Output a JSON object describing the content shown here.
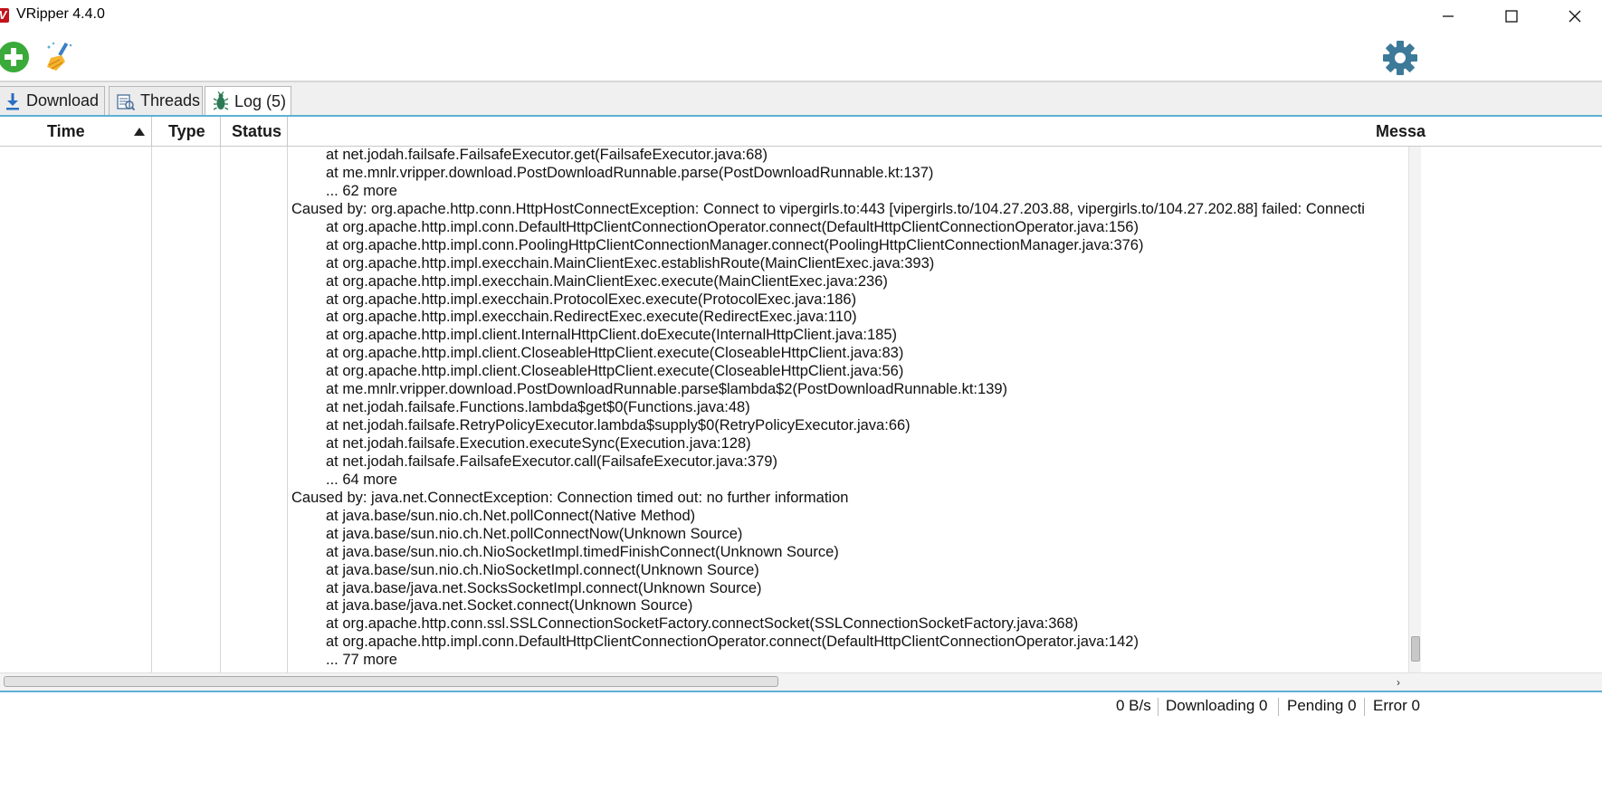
{
  "window": {
    "title": "VRipper 4.4.0",
    "app_icon_letter": "V",
    "controls": [
      "minimize-icon",
      "maximize-icon",
      "close-icon"
    ]
  },
  "toolbar": {
    "icons": [
      "add-icon",
      "clean-icon",
      "gear-icon"
    ]
  },
  "tabs": [
    {
      "label": "Download",
      "icon": "download-icon",
      "active": false
    },
    {
      "label": "Threads",
      "icon": "threads-icon",
      "active": false
    },
    {
      "label": "Log (5)",
      "icon": "bug-icon",
      "active": true
    }
  ],
  "table": {
    "columns": [
      "Time",
      "Type",
      "Status",
      "Messa"
    ],
    "sort_column": "Time",
    "sort_direction": "ascending",
    "message_lines": [
      {
        "text": "at net.jodah.failsafe.FailsafeExecutor.get(FailsafeExecutor.java:68)",
        "indent": true
      },
      {
        "text": "at me.mnlr.vripper.download.PostDownloadRunnable.parse(PostDownloadRunnable.kt:137)",
        "indent": true
      },
      {
        "text": "... 62 more",
        "indent": true
      },
      {
        "text": "Caused by: org.apache.http.conn.HttpHostConnectException: Connect to vipergirls.to:443 [vipergirls.to/104.27.203.88, vipergirls.to/104.27.202.88] failed: Connecti",
        "indent": false
      },
      {
        "text": "at org.apache.http.impl.conn.DefaultHttpClientConnectionOperator.connect(DefaultHttpClientConnectionOperator.java:156)",
        "indent": true
      },
      {
        "text": "at org.apache.http.impl.conn.PoolingHttpClientConnectionManager.connect(PoolingHttpClientConnectionManager.java:376)",
        "indent": true
      },
      {
        "text": "at org.apache.http.impl.execchain.MainClientExec.establishRoute(MainClientExec.java:393)",
        "indent": true
      },
      {
        "text": "at org.apache.http.impl.execchain.MainClientExec.execute(MainClientExec.java:236)",
        "indent": true
      },
      {
        "text": "at org.apache.http.impl.execchain.ProtocolExec.execute(ProtocolExec.java:186)",
        "indent": true
      },
      {
        "text": "at org.apache.http.impl.execchain.RedirectExec.execute(RedirectExec.java:110)",
        "indent": true
      },
      {
        "text": "at org.apache.http.impl.client.InternalHttpClient.doExecute(InternalHttpClient.java:185)",
        "indent": true
      },
      {
        "text": "at org.apache.http.impl.client.CloseableHttpClient.execute(CloseableHttpClient.java:83)",
        "indent": true
      },
      {
        "text": "at org.apache.http.impl.client.CloseableHttpClient.execute(CloseableHttpClient.java:56)",
        "indent": true
      },
      {
        "text": "at me.mnlr.vripper.download.PostDownloadRunnable.parse$lambda$2(PostDownloadRunnable.kt:139)",
        "indent": true
      },
      {
        "text": "at net.jodah.failsafe.Functions.lambda$get$0(Functions.java:48)",
        "indent": true
      },
      {
        "text": "at net.jodah.failsafe.RetryPolicyExecutor.lambda$supply$0(RetryPolicyExecutor.java:66)",
        "indent": true
      },
      {
        "text": "at net.jodah.failsafe.Execution.executeSync(Execution.java:128)",
        "indent": true
      },
      {
        "text": "at net.jodah.failsafe.FailsafeExecutor.call(FailsafeExecutor.java:379)",
        "indent": true
      },
      {
        "text": "... 64 more",
        "indent": true
      },
      {
        "text": "Caused by: java.net.ConnectException: Connection timed out: no further information",
        "indent": false
      },
      {
        "text": "at java.base/sun.nio.ch.Net.pollConnect(Native Method)",
        "indent": true
      },
      {
        "text": "at java.base/sun.nio.ch.Net.pollConnectNow(Unknown Source)",
        "indent": true
      },
      {
        "text": "at java.base/sun.nio.ch.NioSocketImpl.timedFinishConnect(Unknown Source)",
        "indent": true
      },
      {
        "text": "at java.base/sun.nio.ch.NioSocketImpl.connect(Unknown Source)",
        "indent": true
      },
      {
        "text": "at java.base/java.net.SocksSocketImpl.connect(Unknown Source)",
        "indent": true
      },
      {
        "text": "at java.base/java.net.Socket.connect(Unknown Source)",
        "indent": true
      },
      {
        "text": "at org.apache.http.conn.ssl.SSLConnectionSocketFactory.connectSocket(SSLConnectionSocketFactory.java:368)",
        "indent": true
      },
      {
        "text": "at org.apache.http.impl.conn.DefaultHttpClientConnectionOperator.connect(DefaultHttpClientConnectionOperator.java:142)",
        "indent": true
      },
      {
        "text": "... 77 more",
        "indent": true
      }
    ]
  },
  "statusbar": {
    "speed": "0 B/s",
    "downloading": "Downloading 0",
    "pending": "Pending 0",
    "error": "Error 0"
  },
  "colors": {
    "accent": "#5fb0d4",
    "app_icon": "#c1141b",
    "add_button": "#3aaa3a",
    "gear": "#3d7a99"
  }
}
